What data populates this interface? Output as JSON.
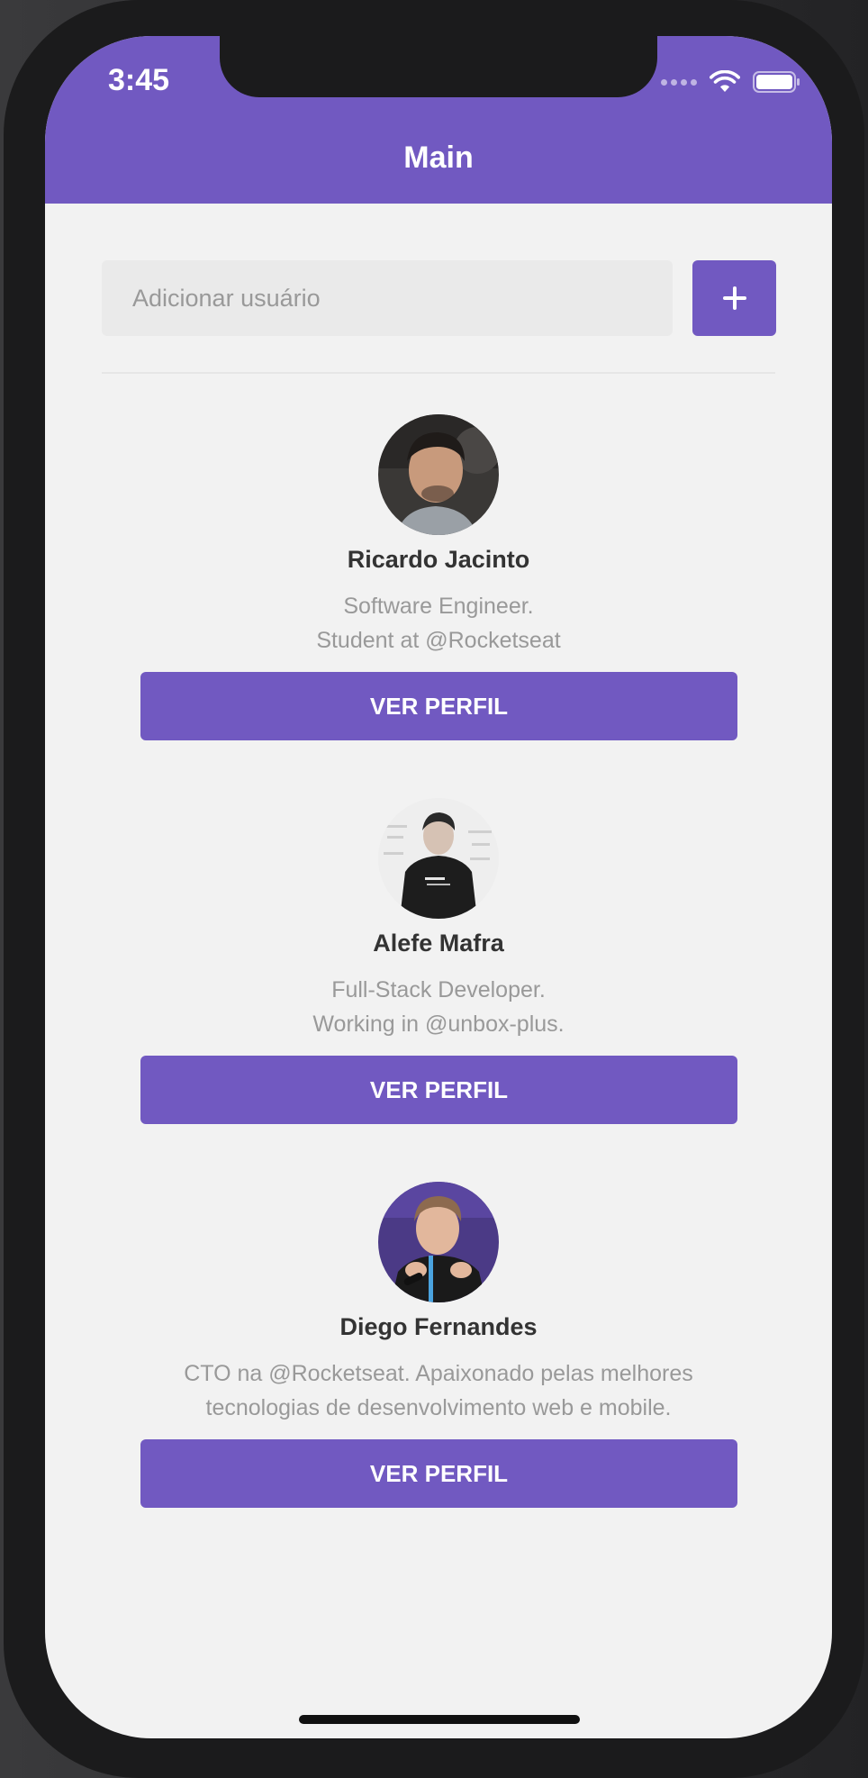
{
  "status_bar": {
    "time": "3:45"
  },
  "header": {
    "title": "Main"
  },
  "form": {
    "placeholder": "Adicionar usuário",
    "value": "",
    "add_icon": "plus-icon"
  },
  "users": [
    {
      "name": "Ricardo Jacinto",
      "bio_line1": "Software Engineer.",
      "bio_line2": "Student at @Rocketseat",
      "button_label": "VER PERFIL"
    },
    {
      "name": "Alefe Mafra",
      "bio_line1": "Full-Stack Developer.",
      "bio_line2": "Working in @unbox-plus.",
      "button_label": "VER PERFIL"
    },
    {
      "name": "Diego Fernandes",
      "bio_line1": "CTO na @Rocketseat. Apaixonado pelas melhores",
      "bio_line2": "tecnologias de desenvolvimento web e mobile.",
      "button_label": "VER PERFIL"
    }
  ],
  "colors": {
    "primary": "#7159c1",
    "background": "#f2f2f2",
    "name_text": "#333333",
    "bio_text": "#999999"
  }
}
